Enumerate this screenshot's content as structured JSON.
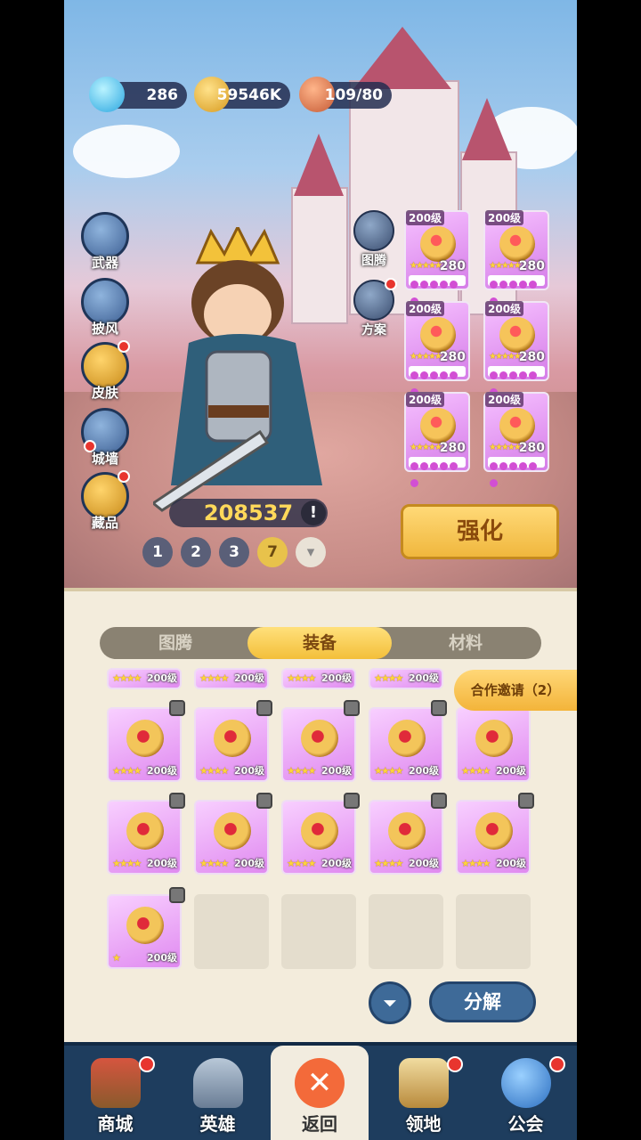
{
  "resources": {
    "gems": "286",
    "gold": "59546K",
    "stamina": "109/80"
  },
  "side_menu": [
    {
      "label": "武器",
      "dot": false
    },
    {
      "label": "披风",
      "dot": false
    },
    {
      "label": "皮肤",
      "dot": true
    },
    {
      "label": "城墙",
      "dot": true
    },
    {
      "label": "藏品",
      "dot": true
    }
  ],
  "mid_menu": [
    {
      "label": "图腾"
    },
    {
      "label": "方案"
    }
  ],
  "hero": {
    "power": "208537",
    "info": "!"
  },
  "presets": [
    "1",
    "2",
    "3",
    "7"
  ],
  "active_preset": "7",
  "equipped": [
    {
      "level": "200级",
      "value": "280"
    },
    {
      "level": "200级",
      "value": "280"
    },
    {
      "level": "200级",
      "value": "280"
    },
    {
      "level": "200级",
      "value": "280"
    },
    {
      "level": "200级",
      "value": "280"
    },
    {
      "level": "200级",
      "value": "280"
    }
  ],
  "enhance_label": "强化",
  "tabs": [
    "图腾",
    "装备",
    "材料"
  ],
  "active_tab": "装备",
  "coop_label": "合作邀请（2）",
  "inventory": {
    "partial_row": [
      "200级",
      "200级",
      "200级",
      "200级"
    ],
    "items": [
      "200级",
      "200级",
      "200级",
      "200级",
      "200级",
      "200级",
      "200级",
      "200级",
      "200级",
      "200级",
      "200级"
    ]
  },
  "filter_icon": "filter-icon",
  "decompose_label": "分解",
  "nav": [
    {
      "label": "商城",
      "dot": true
    },
    {
      "label": "英雄",
      "dot": false
    },
    {
      "label": "返回",
      "dot": false
    },
    {
      "label": "领地",
      "dot": true
    },
    {
      "label": "公会",
      "dot": true
    }
  ],
  "colors": {
    "accent_gold": "#f3bf3a",
    "nav_bg": "#1e3d5e",
    "item_purple": "#e08af0",
    "alert_red": "#e8352e"
  }
}
